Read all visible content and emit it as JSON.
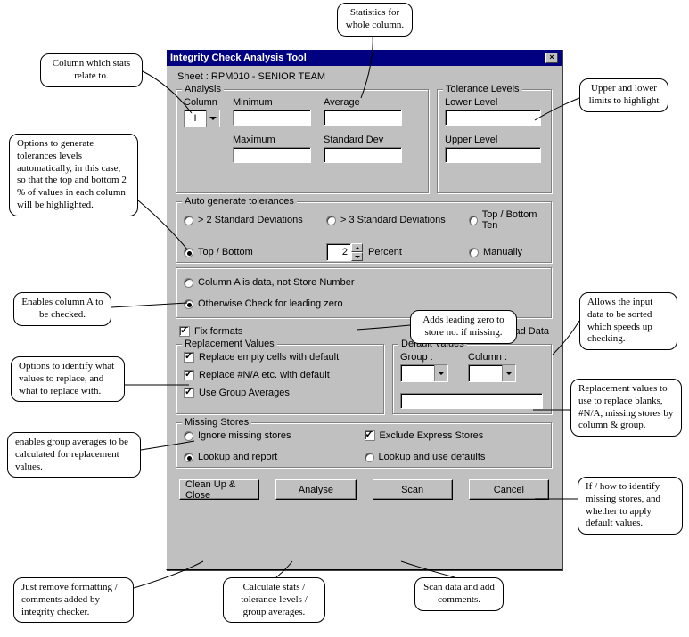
{
  "dialog": {
    "title": "Integrity Check Analysis Tool",
    "sheet_label": "Sheet : RPM010 - SENIOR TEAM"
  },
  "analysis": {
    "group_title": "Analysis",
    "column_label": "Column",
    "column_value": "I",
    "minimum_label": "Minimum",
    "average_label": "Average",
    "maximum_label": "Maximum",
    "stddev_label": "Standard Dev"
  },
  "tolerance": {
    "group_title": "Tolerance Levels",
    "lower_label": "Lower Level",
    "upper_label": "Upper Level"
  },
  "autogen": {
    "group_title": "Auto generate tolerances",
    "opt_2sd": "> 2 Standard Deviations",
    "opt_3sd": "> 3 Standard Deviations",
    "opt_topten": "Top / Bottom Ten",
    "opt_tb": "Top / Bottom",
    "tb_value": "2",
    "tb_unit": "Percent",
    "opt_manual": "Manually"
  },
  "columnA": {
    "radio_is_data": "Column A is data, not Store Number",
    "radio_leading_zero": "Otherwise Check for leading zero"
  },
  "fix_formats_label": "Fix formats",
  "enable_sort_label": "Enable Sort of Upload Data",
  "replacement": {
    "group_title": "Replacement Values",
    "empty": "Replace empty cells with default",
    "na": "Replace #N/A etc. with default",
    "groupavg": "Use Group Averages"
  },
  "defaults": {
    "group_title": "Default Values",
    "group_label": "Group :",
    "column_label": "Column :"
  },
  "missing": {
    "group_title": "Missing Stores",
    "ignore": "Ignore missing stores",
    "lookup_report": "Lookup and report",
    "exclude_express": "Exclude Express Stores",
    "lookup_defaults": "Lookup and use defaults"
  },
  "buttons": {
    "clean": "Clean Up & Close",
    "analyse": "Analyse",
    "scan": "Scan",
    "cancel": "Cancel"
  },
  "callouts": {
    "c1": "Column which stats relate to.",
    "c2": "Statistics for whole column.",
    "c3": "Upper and lower limits to highlight",
    "c4": "Options to generate tolerances levels automatically, in this case, so that the top and bottom 2 % of values in each column will be highlighted.",
    "c5": "Enables column A to be checked.",
    "c6": "Adds leading zero to store no. if missing.",
    "c7": "Allows the input data to be sorted which speeds up checking.",
    "c8": "Options to identify what values to replace, and what to replace with.",
    "c9": "Replacement values to use to replace blanks, #N/A, missing stores by column & group.",
    "c10": "enables group averages to be calculated for replacement values.",
    "c11": "If / how to identify missing stores, and whether to apply default values.",
    "c12": "Just remove formatting / comments added by integrity checker.",
    "c13": "Calculate stats / tolerance levels / group averages.",
    "c14": "Scan data and add comments."
  }
}
